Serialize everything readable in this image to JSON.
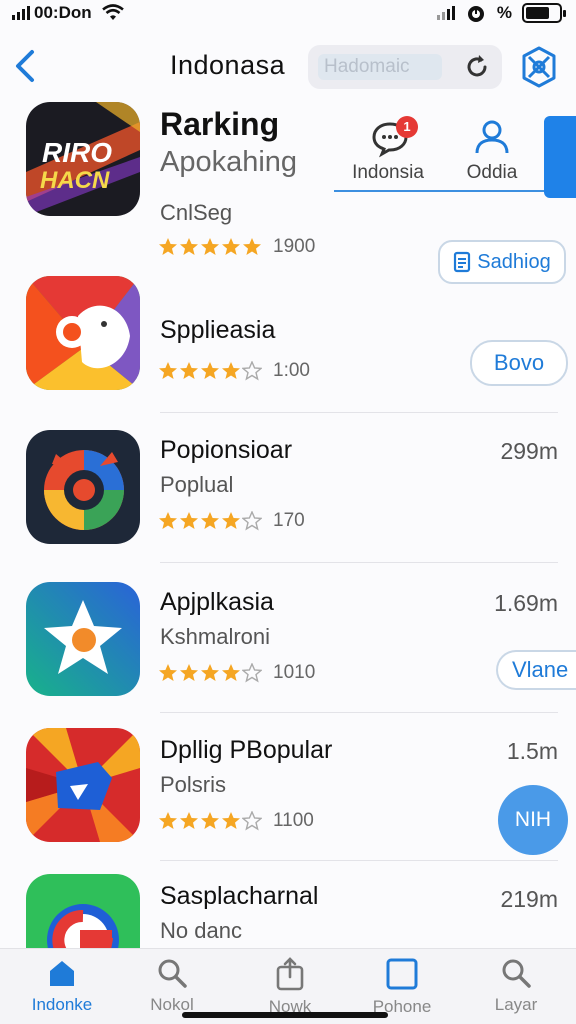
{
  "status_bar": {
    "time": "00:Don",
    "battery_percent": "%"
  },
  "header": {
    "title": "Indonasa",
    "search_placeholder": "Hadomaic"
  },
  "top_tabs": [
    {
      "label": "Indonsia",
      "badge": "1",
      "icon": "chat-icon"
    },
    {
      "label": "Oddia",
      "icon": "person-icon"
    }
  ],
  "apps": [
    {
      "name": "Rarking",
      "subtitle": "Apokahing",
      "category": "CnlSeg",
      "stars": 5,
      "rating_count": "1900",
      "action_label": "Sadhiog",
      "icon_text": "RIRO HACN"
    },
    {
      "name": "Spplieasia",
      "stars": 4,
      "rating_count": "1:00",
      "action_label": "Bovo"
    },
    {
      "name": "Popionsioar",
      "subtitle": "Poplual",
      "stars": 4,
      "rating_count": "170",
      "size": "299m"
    },
    {
      "name": "Apjplkasia",
      "subtitle": "Kshmalroni",
      "stars": 4,
      "rating_count": "1010",
      "size": "1.69m",
      "action_label": "Vlane"
    },
    {
      "name": "Dpllig PBopular",
      "subtitle": "Polsris",
      "stars": 4,
      "rating_count": "1100",
      "size": "1.5m"
    },
    {
      "name": "Sasplacharnal",
      "subtitle": "No danc",
      "size": "219m"
    }
  ],
  "fab_label": "NIH",
  "tab_bar": [
    {
      "label": "Indonke",
      "icon": "home-icon",
      "active": true
    },
    {
      "label": "Nokol",
      "icon": "search-icon"
    },
    {
      "label": "Nowk",
      "icon": "share-icon"
    },
    {
      "label": "Pohone",
      "icon": "square-icon"
    },
    {
      "label": "Layar",
      "icon": "search-icon"
    }
  ],
  "colors": {
    "accent": "#1f7bd8",
    "star": "#f5a623"
  }
}
